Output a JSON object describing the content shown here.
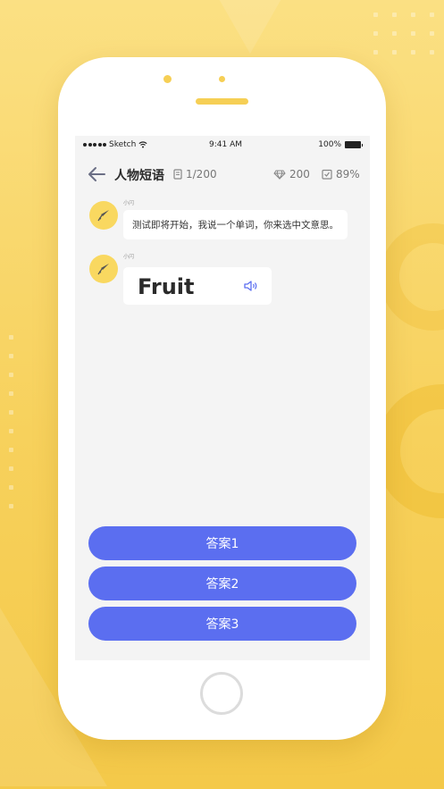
{
  "status_bar": {
    "carrier": "Sketch",
    "time": "9:41 AM",
    "battery": "100%"
  },
  "nav": {
    "title": "人物短语",
    "progress": "1/200",
    "gems": "200",
    "accuracy": "89%"
  },
  "messages": [
    {
      "sender": "小闪",
      "text": "测试即将开始，我说一个单词，你来选中文意思。"
    },
    {
      "sender": "小闪",
      "word": "Fruit"
    }
  ],
  "answers": [
    "答案1",
    "答案2",
    "答案3"
  ],
  "colors": {
    "background": "#f8d668",
    "accent": "#5b6ef0",
    "avatar": "#f9d860",
    "screen": "#f4f4f4"
  },
  "icons": [
    "back-arrow-icon",
    "book-icon",
    "diamond-icon",
    "checkbox-icon",
    "rocket-icon",
    "speaker-icon",
    "wifi-icon",
    "battery-icon"
  ]
}
